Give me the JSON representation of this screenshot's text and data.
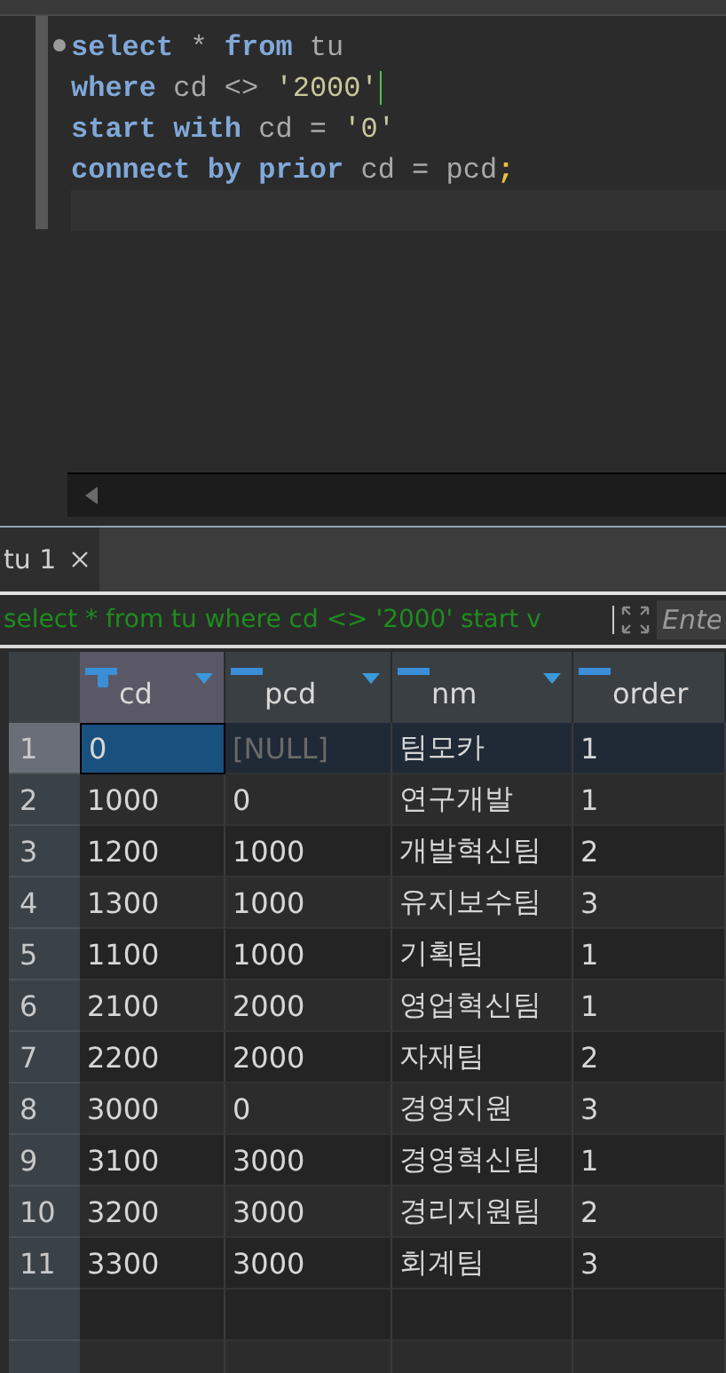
{
  "editor": {
    "lines": [
      [
        {
          "kind": "keyword",
          "text": "select"
        },
        {
          "kind": "plain",
          "text": " * "
        },
        {
          "kind": "keyword",
          "text": "from"
        },
        {
          "kind": "plain",
          "text": " tu"
        }
      ],
      [
        {
          "kind": "keyword",
          "text": "where"
        },
        {
          "kind": "plain",
          "text": " cd <> "
        },
        {
          "kind": "string",
          "text": "'2000'"
        }
      ],
      [
        {
          "kind": "keyword",
          "text": "start "
        },
        {
          "kind": "keyword",
          "text": "with"
        },
        {
          "kind": "plain",
          "text": " cd = "
        },
        {
          "kind": "string",
          "text": "'0'"
        }
      ],
      [
        {
          "kind": "keyword",
          "text": "connect "
        },
        {
          "kind": "keyword",
          "text": "by "
        },
        {
          "kind": "keyword",
          "text": "prior"
        },
        {
          "kind": "plain",
          "text": " cd = pcd"
        },
        {
          "kind": "punct",
          "text": ";"
        }
      ]
    ]
  },
  "result_tabs": [
    {
      "label": "tu 1",
      "selected": true
    }
  ],
  "filter": {
    "text": "select * from tu where cd <> '2000' start v",
    "placeholder": "Ente"
  },
  "table": {
    "columns": [
      {
        "name": "cd",
        "key": true
      },
      {
        "name": "pcd",
        "key": false
      },
      {
        "name": "nm",
        "key": false
      },
      {
        "name": "order",
        "key": false
      }
    ],
    "rows": [
      {
        "num": "1",
        "selected": true,
        "cells": [
          {
            "kind": "value",
            "text": "0"
          },
          {
            "kind": "null",
            "text": "[NULL]"
          },
          {
            "kind": "value",
            "text": "팀모카"
          },
          {
            "kind": "value",
            "text": "1"
          }
        ]
      },
      {
        "num": "2",
        "selected": false,
        "cells": [
          {
            "kind": "value",
            "text": "1000"
          },
          {
            "kind": "value",
            "text": "0"
          },
          {
            "kind": "value",
            "text": "연구개발"
          },
          {
            "kind": "value",
            "text": "1"
          }
        ]
      },
      {
        "num": "3",
        "selected": false,
        "cells": [
          {
            "kind": "value",
            "text": "1200"
          },
          {
            "kind": "value",
            "text": "1000"
          },
          {
            "kind": "value",
            "text": "개발혁신팀"
          },
          {
            "kind": "value",
            "text": "2"
          }
        ]
      },
      {
        "num": "4",
        "selected": false,
        "cells": [
          {
            "kind": "value",
            "text": "1300"
          },
          {
            "kind": "value",
            "text": "1000"
          },
          {
            "kind": "value",
            "text": "유지보수팀"
          },
          {
            "kind": "value",
            "text": "3"
          }
        ]
      },
      {
        "num": "5",
        "selected": false,
        "cells": [
          {
            "kind": "value",
            "text": "1100"
          },
          {
            "kind": "value",
            "text": "1000"
          },
          {
            "kind": "value",
            "text": "기획팀"
          },
          {
            "kind": "value",
            "text": "1"
          }
        ]
      },
      {
        "num": "6",
        "selected": false,
        "cells": [
          {
            "kind": "value",
            "text": "2100"
          },
          {
            "kind": "value",
            "text": "2000"
          },
          {
            "kind": "value",
            "text": "영업혁신팀"
          },
          {
            "kind": "value",
            "text": "1"
          }
        ]
      },
      {
        "num": "7",
        "selected": false,
        "cells": [
          {
            "kind": "value",
            "text": "2200"
          },
          {
            "kind": "value",
            "text": "2000"
          },
          {
            "kind": "value",
            "text": "자재팀"
          },
          {
            "kind": "value",
            "text": "2"
          }
        ]
      },
      {
        "num": "8",
        "selected": false,
        "cells": [
          {
            "kind": "value",
            "text": "3000"
          },
          {
            "kind": "value",
            "text": "0"
          },
          {
            "kind": "value",
            "text": "경영지원"
          },
          {
            "kind": "value",
            "text": "3"
          }
        ]
      },
      {
        "num": "9",
        "selected": false,
        "cells": [
          {
            "kind": "value",
            "text": "3100"
          },
          {
            "kind": "value",
            "text": "3000"
          },
          {
            "kind": "value",
            "text": "경영혁신팀"
          },
          {
            "kind": "value",
            "text": "1"
          }
        ]
      },
      {
        "num": "10",
        "selected": false,
        "cells": [
          {
            "kind": "value",
            "text": "3200"
          },
          {
            "kind": "value",
            "text": "3000"
          },
          {
            "kind": "value",
            "text": "경리지원팀"
          },
          {
            "kind": "value",
            "text": "2"
          }
        ]
      },
      {
        "num": "11",
        "selected": false,
        "cells": [
          {
            "kind": "value",
            "text": "3300"
          },
          {
            "kind": "value",
            "text": "3000"
          },
          {
            "kind": "value",
            "text": "회계팀"
          },
          {
            "kind": "value",
            "text": "3"
          }
        ]
      }
    ]
  }
}
